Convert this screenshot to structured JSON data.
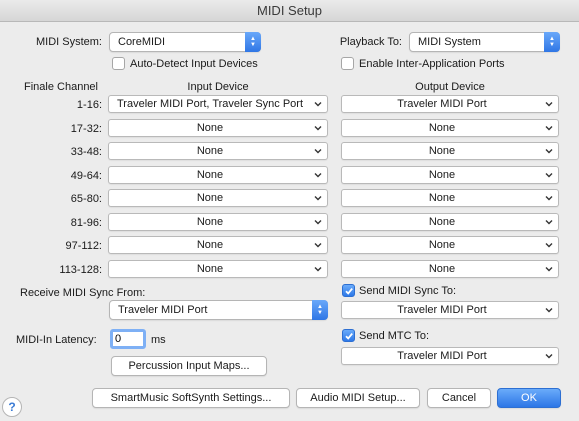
{
  "window": {
    "title": "MIDI Setup"
  },
  "midi_system": {
    "label": "MIDI System:",
    "value": "CoreMIDI"
  },
  "auto_detect": {
    "label": "Auto-Detect Input Devices",
    "checked": false
  },
  "playback_to": {
    "label": "Playback To:",
    "value": "MIDI System"
  },
  "inter_app": {
    "label": "Enable Inter-Application Ports",
    "checked": false
  },
  "headers": {
    "channel": "Finale Channel",
    "input": "Input Device",
    "output": "Output Device"
  },
  "rows": [
    {
      "channel": "1-16:",
      "input": "Traveler MIDI Port, Traveler Sync Port",
      "output": "Traveler MIDI Port"
    },
    {
      "channel": "17-32:",
      "input": "None",
      "output": "None"
    },
    {
      "channel": "33-48:",
      "input": "None",
      "output": "None"
    },
    {
      "channel": "49-64:",
      "input": "None",
      "output": "None"
    },
    {
      "channel": "65-80:",
      "input": "None",
      "output": "None"
    },
    {
      "channel": "81-96:",
      "input": "None",
      "output": "None"
    },
    {
      "channel": "97-112:",
      "input": "None",
      "output": "None"
    },
    {
      "channel": "113-128:",
      "input": "None",
      "output": "None"
    }
  ],
  "receive_sync": {
    "label": "Receive MIDI Sync From:",
    "value": "Traveler MIDI Port"
  },
  "send_sync": {
    "label": "Send MIDI Sync To:",
    "checked": true,
    "value": "Traveler MIDI Port"
  },
  "latency": {
    "label": "MIDI-In Latency:",
    "value": "0",
    "unit": "ms"
  },
  "send_mtc": {
    "label": "Send MTC To:",
    "checked": true,
    "value": "Traveler MIDI Port"
  },
  "buttons": {
    "percussion": "Percussion Input Maps...",
    "smartmusic": "SmartMusic SoftSynth Settings...",
    "audio_midi": "Audio MIDI Setup...",
    "cancel": "Cancel",
    "ok": "OK",
    "help": "?"
  },
  "colors": {
    "accent": "#2f76e5",
    "background": "#ececec"
  },
  "icons": {
    "popup": "up-down-arrows-icon",
    "dropdown": "chevron-down-icon",
    "check": "checkmark-icon"
  }
}
